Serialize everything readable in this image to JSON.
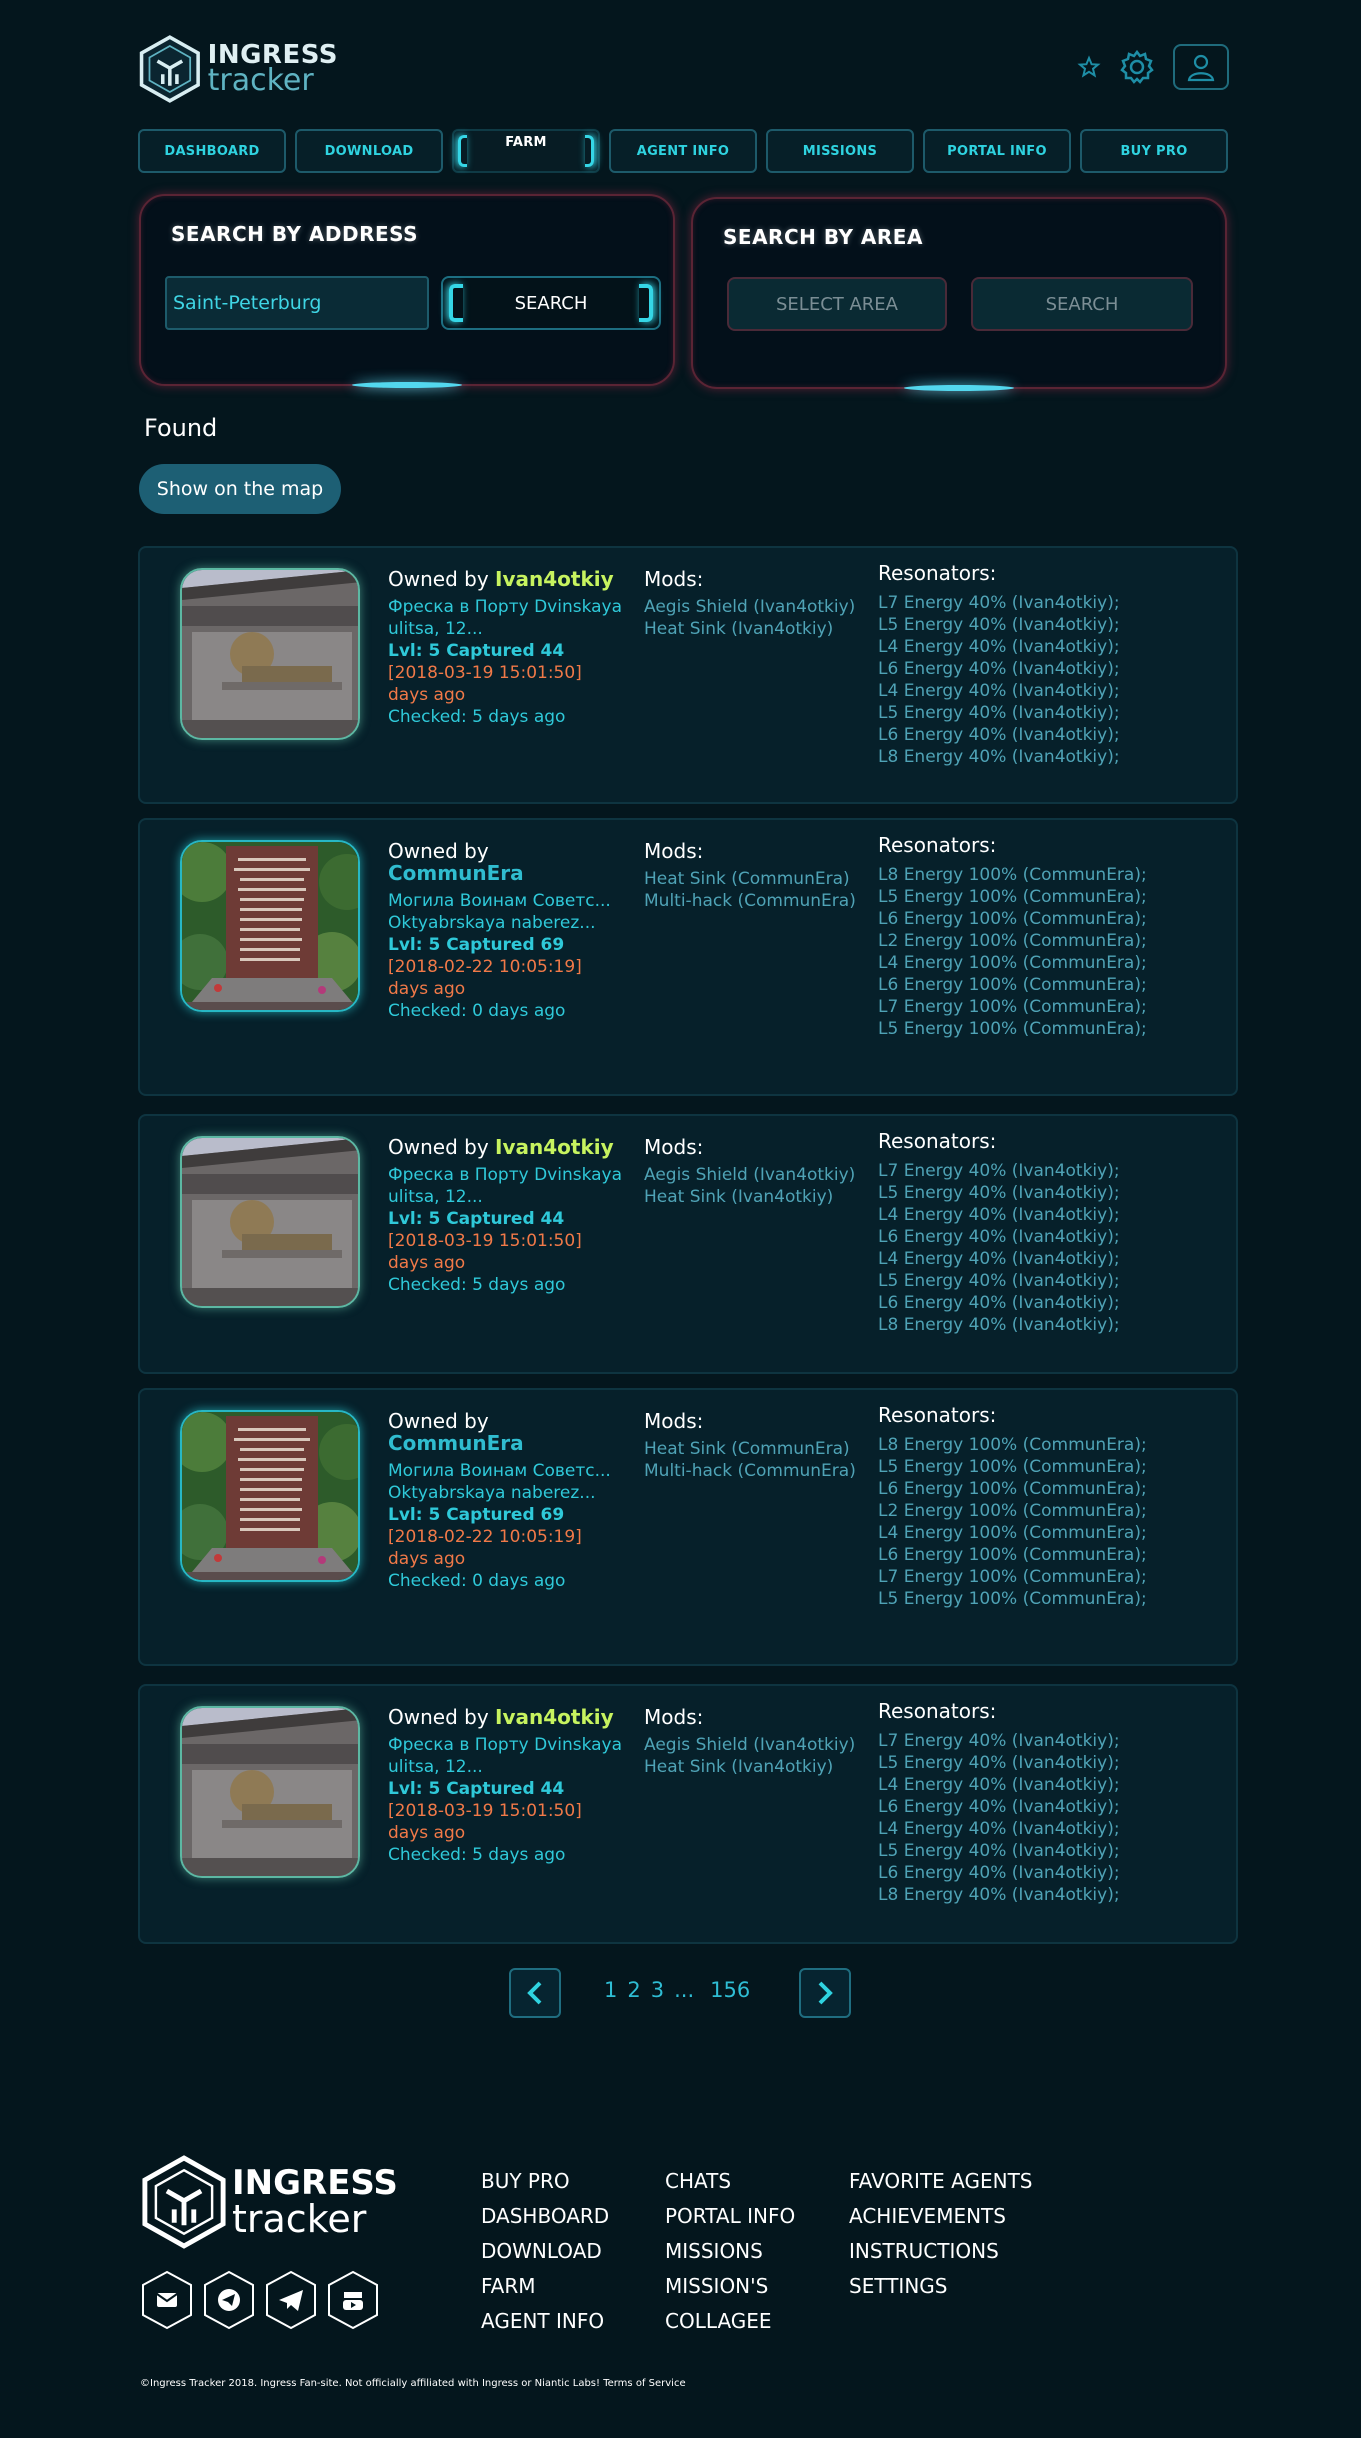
{
  "brand": {
    "line1": "INGRESS",
    "line2": "tracker"
  },
  "header_icons": [
    "star-icon",
    "gear-icon",
    "user-icon"
  ],
  "nav": [
    {
      "label": "DASHBOARD"
    },
    {
      "label": "DOWNLOAD"
    },
    {
      "label": "FARM",
      "active": true
    },
    {
      "label": "AGENT INFO"
    },
    {
      "label": "MISSIONS"
    },
    {
      "label": "PORTAL INFO"
    },
    {
      "label": "BUY PRO"
    }
  ],
  "search_address": {
    "title": "SEARCH BY ADDRESS",
    "value": "Saint-Peterburg",
    "button": "SEARCH"
  },
  "search_area": {
    "title": "SEARCH BY AREA",
    "select": "SELECT AREA",
    "button": "SEARCH"
  },
  "found_label": "Found",
  "show_map_label": "Show on the map",
  "labels": {
    "owned_by": "Owned by",
    "mods": "Mods:",
    "resonators": "Resonators:"
  },
  "colors": {
    "accent": "#2fd3e0",
    "owner_enl": "#c7f35f",
    "owner_res": "#30bdd0",
    "date": "#f07948",
    "panel_border": "#5a2434"
  },
  "portals": [
    {
      "owner": "Ivan4otkiy",
      "owner_color": "yellow",
      "image": "fresco-building",
      "name": "Фреска в Порту Dvinskaya",
      "address": "ulitsa, 12...",
      "level": "Lvl: 5 Captured 44",
      "date": "[2018-03-19 15:01:50]",
      "days": "days ago",
      "checked": "Checked: 5 days ago",
      "mods": [
        "Aegis Shield (Ivan4otkiy)",
        "Heat Sink (Ivan4otkiy)"
      ],
      "resonators": [
        "L7 Energy 40% (Ivan4otkiy);",
        "L5 Energy 40% (Ivan4otkiy);",
        "L4 Energy 40% (Ivan4otkiy);",
        "L6 Energy 40% (Ivan4otkiy);",
        "L4 Energy 40% (Ivan4otkiy);",
        "L5 Energy 40% (Ivan4otkiy);",
        "L6 Energy 40% (Ivan4otkiy);",
        "L8 Energy 40% (Ivan4otkiy);"
      ]
    },
    {
      "owner": "CommunEra",
      "owner_color": "cyan",
      "image": "memorial-stone",
      "name": "Могила Воинам Советс...",
      "address": "Oktyabrskaya naberez...",
      "level": "Lvl: 5 Captured 69",
      "date": "[2018-02-22 10:05:19]",
      "days": "days ago",
      "checked": "Checked: 0 days ago",
      "mods": [
        "Heat Sink (CommunEra)",
        "Multi-hack (CommunEra)"
      ],
      "resonators": [
        "L8 Energy 100% (CommunEra);",
        "L5 Energy 100% (CommunEra);",
        "L6 Energy 100% (CommunEra);",
        "L2 Energy 100% (CommunEra);",
        "L4 Energy 100% (CommunEra);",
        "L6 Energy 100% (CommunEra);",
        "L7 Energy 100% (CommunEra);",
        "L5 Energy 100% (CommunEra);"
      ]
    },
    {
      "owner": "Ivan4otkiy",
      "owner_color": "yellow",
      "image": "fresco-building",
      "name": "Фреска в Порту Dvinskaya",
      "address": "ulitsa, 12...",
      "level": "Lvl: 5 Captured 44",
      "date": "[2018-03-19 15:01:50]",
      "days": "days ago",
      "checked": "Checked: 5 days ago",
      "mods": [
        "Aegis Shield (Ivan4otkiy)",
        "Heat Sink (Ivan4otkiy)"
      ],
      "resonators": [
        "L7 Energy 40% (Ivan4otkiy);",
        "L5 Energy 40% (Ivan4otkiy);",
        "L4 Energy 40% (Ivan4otkiy);",
        "L6 Energy 40% (Ivan4otkiy);",
        "L4 Energy 40% (Ivan4otkiy);",
        "L5 Energy 40% (Ivan4otkiy);",
        "L6 Energy 40% (Ivan4otkiy);",
        "L8 Energy 40% (Ivan4otkiy);"
      ]
    },
    {
      "owner": "CommunEra",
      "owner_color": "cyan",
      "image": "memorial-stone",
      "name": "Могила Воинам Советс...",
      "address": "Oktyabrskaya naberez...",
      "level": "Lvl: 5 Captured 69",
      "date": "[2018-02-22 10:05:19]",
      "days": "days ago",
      "checked": "Checked: 0 days ago",
      "mods": [
        "Heat Sink (CommunEra)",
        "Multi-hack (CommunEra)"
      ],
      "resonators": [
        "L8 Energy 100% (CommunEra);",
        "L5 Energy 100% (CommunEra);",
        "L6 Energy 100% (CommunEra);",
        "L2 Energy 100% (CommunEra);",
        "L4 Energy 100% (CommunEra);",
        "L6 Energy 100% (CommunEra);",
        "L7 Energy 100% (CommunEra);",
        "L5 Energy 100% (CommunEra);"
      ]
    },
    {
      "owner": "Ivan4otkiy",
      "owner_color": "yellow",
      "image": "fresco-building",
      "name": "Фреска в Порту Dvinskaya",
      "address": "ulitsa, 12...",
      "level": "Lvl: 5 Captured 44",
      "date": "[2018-03-19 15:01:50]",
      "days": "days ago",
      "checked": "Checked: 5 days ago",
      "mods": [
        "Aegis Shield (Ivan4otkiy)",
        "Heat Sink (Ivan4otkiy)"
      ],
      "resonators": [
        "L7 Energy 40% (Ivan4otkiy);",
        "L5 Energy 40% (Ivan4otkiy);",
        "L4 Energy 40% (Ivan4otkiy);",
        "L6 Energy 40% (Ivan4otkiy);",
        "L4 Energy 40% (Ivan4otkiy);",
        "L5 Energy 40% (Ivan4otkiy);",
        "L6 Energy 40% (Ivan4otkiy);",
        "L8 Energy 40% (Ivan4otkiy);"
      ]
    }
  ],
  "pagination": {
    "pages": [
      "1",
      "2",
      "3",
      "...",
      "156"
    ]
  },
  "footer": {
    "brand": {
      "line1": "INGRESS",
      "line2": "tracker"
    },
    "social": [
      "mail-icon",
      "telegram-round-icon",
      "telegram-icon",
      "youtube-icon"
    ],
    "col1": [
      "BUY PRO",
      "DASHBOARD",
      "DOWNLOAD",
      "FARM",
      "AGENT INFO"
    ],
    "col2": [
      "CHATS",
      "PORTAL INFO",
      "MISSIONS",
      "MISSION'S",
      "COLLAGEE"
    ],
    "col3": [
      "FAVORITE AGENTS",
      "ACHIEVEMENTS",
      "INSTRUCTIONS",
      "SETTINGS"
    ],
    "copyright": "©Ingress Tracker 2018. Ingress Fan-site. Not officially affiliated with Ingress or Niantic Labs! Terms of Service"
  }
}
